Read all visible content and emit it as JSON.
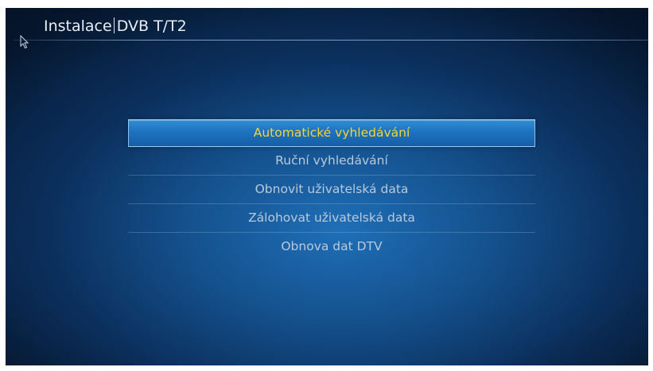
{
  "header": {
    "section": "Instalace",
    "subsection": "DVB T/T2"
  },
  "menu": {
    "items": [
      {
        "label": "Automatické vyhledávání",
        "selected": true
      },
      {
        "label": "Ruční vyhledávání",
        "selected": false
      },
      {
        "label": "Obnovit uživatelská data",
        "selected": false
      },
      {
        "label": "Zálohovat uživatelská data",
        "selected": false
      },
      {
        "label": "Obnova dat DTV",
        "selected": false
      }
    ]
  },
  "colors": {
    "selected_text": "#f3d630",
    "normal_text": "#b9c9db",
    "highlight": "#1f72bf",
    "background": "#14508c"
  },
  "icons": {
    "cursor": "mouse-pointer-icon"
  }
}
